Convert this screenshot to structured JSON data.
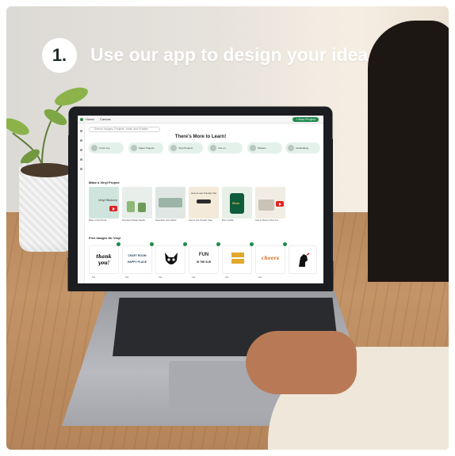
{
  "headline": {
    "step_number": "1.",
    "text": "Use our app to design your idea"
  },
  "screen": {
    "tabs": [
      "Home",
      "Canvas"
    ],
    "start_button": "+ New Project",
    "search_placeholder": "Search images, Projects, fonts, and Profiles",
    "learn_title": "There's More to Learn!",
    "categories": [
      "Cricut Joy",
      "Paper Projects",
      "Vinyl Projects",
      "Iron-on",
      "Stickers",
      "Cardmaking"
    ],
    "vinyl_section": "Make a Vinyl Project",
    "vinyl_thumbs": [
      {
        "caption": "Make a Vinyl Decal",
        "label": "Vinyl Stickers"
      },
      {
        "caption": "Succulent Planter Decals",
        "label": ""
      },
      {
        "caption": "Decorative Jars Labels",
        "label": ""
      },
      {
        "caption": "How to Use Transfer Tape",
        "label": "How to use Transfer Tape"
      },
      {
        "caption": "Mom Candle",
        "label": "Mom"
      },
      {
        "caption": "How to Weed a Vinyl Cut",
        "label": ""
      }
    ],
    "free_section": "Free Images for Vinyl",
    "free_cards": [
      {
        "text_top": "thank",
        "text_bottom": "you!",
        "foot": "Cut"
      },
      {
        "text_top": "CRAFT ROOM",
        "text_bottom": "HAPPY PLACE",
        "foot": "Cut"
      },
      {
        "text_top": "",
        "text_bottom": "",
        "foot": "Cut"
      },
      {
        "text_top": "FUN",
        "text_bottom": "IN THE SUN",
        "foot": "Cut"
      },
      {
        "text_top": "",
        "text_bottom": "",
        "foot": "Cut"
      },
      {
        "text_top": "cheers",
        "text_bottom": "",
        "foot": "Cut"
      }
    ],
    "accent_color": "#1e8a4c",
    "pill_color": "#e3f1ea"
  }
}
